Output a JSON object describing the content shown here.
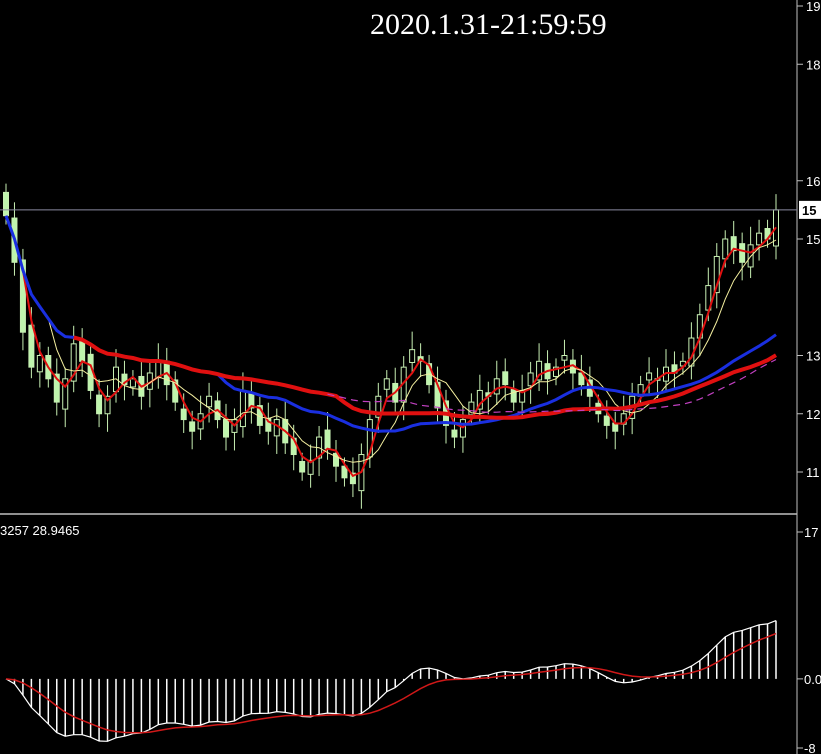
{
  "chart": {
    "datetime_label": "2020.1.31-21:59:59",
    "current_price_label": "15",
    "price_axis_ticks": [
      {
        "label": "19",
        "value": 19.0
      },
      {
        "label": "18",
        "value": 18.0
      },
      {
        "label": "16",
        "value": 16.0
      },
      {
        "label": "15",
        "value": 15.0
      },
      {
        "label": "13",
        "value": 13.0
      },
      {
        "label": "12",
        "value": 12.0
      },
      {
        "label": "11",
        "value": 11.0
      }
    ],
    "indicator_axis_ticks": [
      {
        "label": "17",
        "value": 17
      },
      {
        "label": "0.0",
        "value": 0
      },
      {
        "label": "-8",
        "value": -8
      }
    ],
    "indicator_values_label": "3257 28.9465",
    "colors": {
      "background": "#000000",
      "bull_candle": "#c8f0b4",
      "bear_candle": "#bff5ad",
      "ma_fast_red": "#e01010",
      "ma_slow_red": "#e01010",
      "ma_yellow": "#f5f0a0",
      "ma_blue": "#1a2fe0",
      "ma_magenta_dashed": "#c040c0",
      "macd_line": "#ffffff",
      "signal_line": "#d01818",
      "histogram": "#ffffff",
      "price_line": "#8a8aa0"
    }
  },
  "chart_data": {
    "type": "line",
    "current_price": 15.5,
    "price_ylim": [
      10.6,
      19.2
    ],
    "indicator_ylim": [
      -9,
      17.5
    ]
  }
}
